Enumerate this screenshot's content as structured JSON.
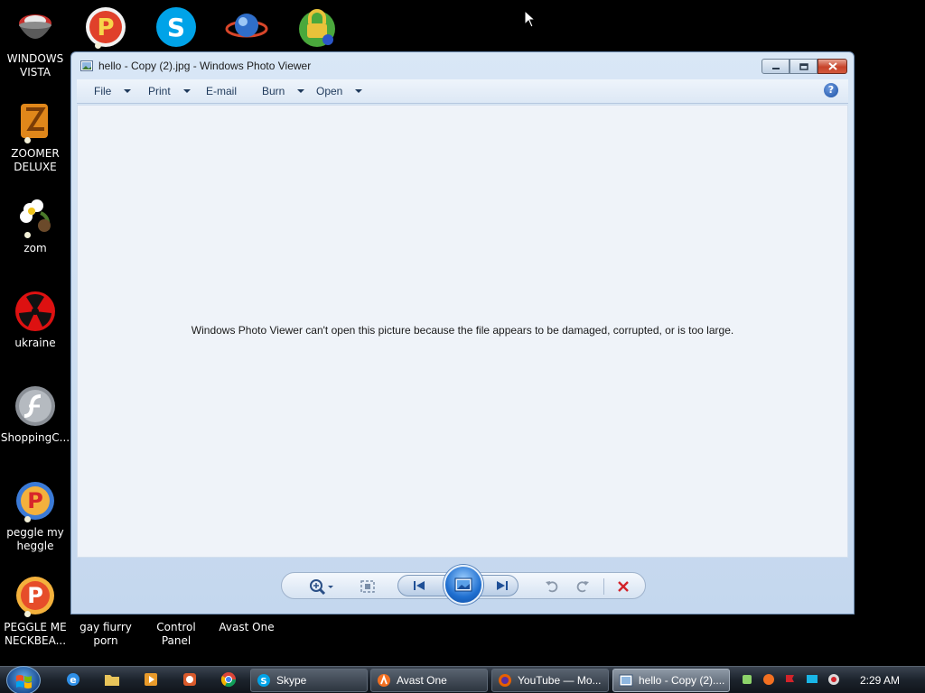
{
  "desktop_icons": [
    {
      "label": "WINDOWS VISTA",
      "icon": "cauldron-icon"
    },
    {
      "label": "",
      "icon": "peggle-icon"
    },
    {
      "label": "",
      "icon": "skype-icon"
    },
    {
      "label": "",
      "icon": "globe-icon"
    },
    {
      "label": "",
      "icon": "lock-icon"
    },
    {
      "label": "ZOOMER DELUXE",
      "icon": "zoomer-icon"
    },
    {
      "label": "zom",
      "icon": "flower-icon"
    },
    {
      "label": "ukraine",
      "icon": "radiation-icon"
    },
    {
      "label": "ShoppingC...",
      "icon": "flash-icon"
    },
    {
      "label": "peggle my heggle",
      "icon": "peggle-icon"
    },
    {
      "label": "PEGGLE ME NECKBEA...",
      "icon": "peggle-icon"
    },
    {
      "label": "gay fiurry porn",
      "icon": "file-icon"
    },
    {
      "label": "Control Panel",
      "icon": "control-panel-icon"
    },
    {
      "label": "Avast One",
      "icon": "avast-icon"
    }
  ],
  "window": {
    "title": "hello - Copy (2).jpg - Windows Photo Viewer",
    "menu": {
      "file": "File",
      "print": "Print",
      "email": "E-mail",
      "burn": "Burn",
      "open": "Open"
    },
    "help": "?",
    "error_message": "Windows Photo Viewer can't open this picture because the file appears to be damaged, corrupted, or is too large."
  },
  "taskbar": {
    "buttons": [
      {
        "label": "Skype",
        "icon": "skype-icon"
      },
      {
        "label": "Avast One",
        "icon": "avast-icon"
      },
      {
        "label": "YouTube — Mo...",
        "icon": "firefox-icon"
      },
      {
        "label": "hello - Copy (2)....",
        "icon": "photo-viewer-icon"
      }
    ],
    "clock": "2:29 AM"
  },
  "colors": {
    "accent": "#1f6fd0",
    "close": "#c7432a",
    "desktop": "#000000"
  }
}
